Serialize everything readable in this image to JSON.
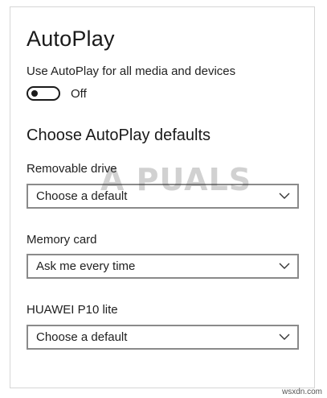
{
  "window": {
    "title": "AutoPlay"
  },
  "autoplay_toggle": {
    "label": "Use AutoPlay for all media and devices",
    "state": "Off",
    "on": false
  },
  "defaults": {
    "heading": "Choose AutoPlay defaults",
    "items": [
      {
        "label": "Removable drive",
        "value": "Choose a default"
      },
      {
        "label": "Memory card",
        "value": "Ask me every time"
      },
      {
        "label": "HUAWEI P10 lite",
        "value": "Choose a default"
      }
    ]
  },
  "overlay": {
    "watermark": "A PUALS",
    "credit": "wsxdn.com"
  },
  "icons": {
    "dropdown": "chevron-down-icon",
    "toggle": "toggle-switch-icon"
  }
}
